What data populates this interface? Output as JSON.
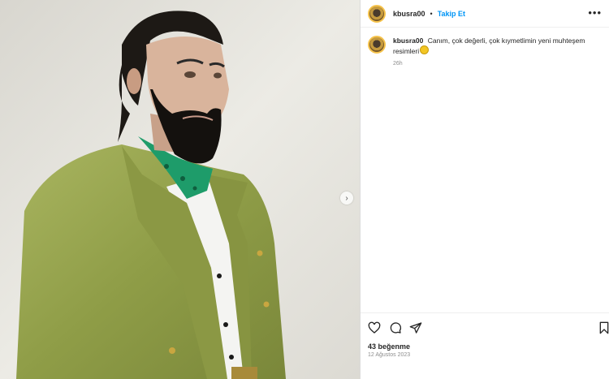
{
  "post": {
    "username": "kbusra00",
    "separator": "•",
    "follow_label": "Takip Et",
    "more_label": "•••",
    "caption_user": "kbusra00",
    "caption_text": "Canım, çok değerli, çok kıymetlimin yeni muhteşem resimleri",
    "time_ago": "26h",
    "likes": "43 beğenme",
    "date": "12 Ağustos 2023"
  },
  "icons": {
    "like": "heart-icon",
    "comment": "comment-icon",
    "share": "send-icon",
    "save": "bookmark-icon",
    "next": "chevron-right-icon"
  },
  "colors": {
    "accent": "#0095f6",
    "suit": "#9aa64f",
    "scarf": "#1e9c6a"
  }
}
